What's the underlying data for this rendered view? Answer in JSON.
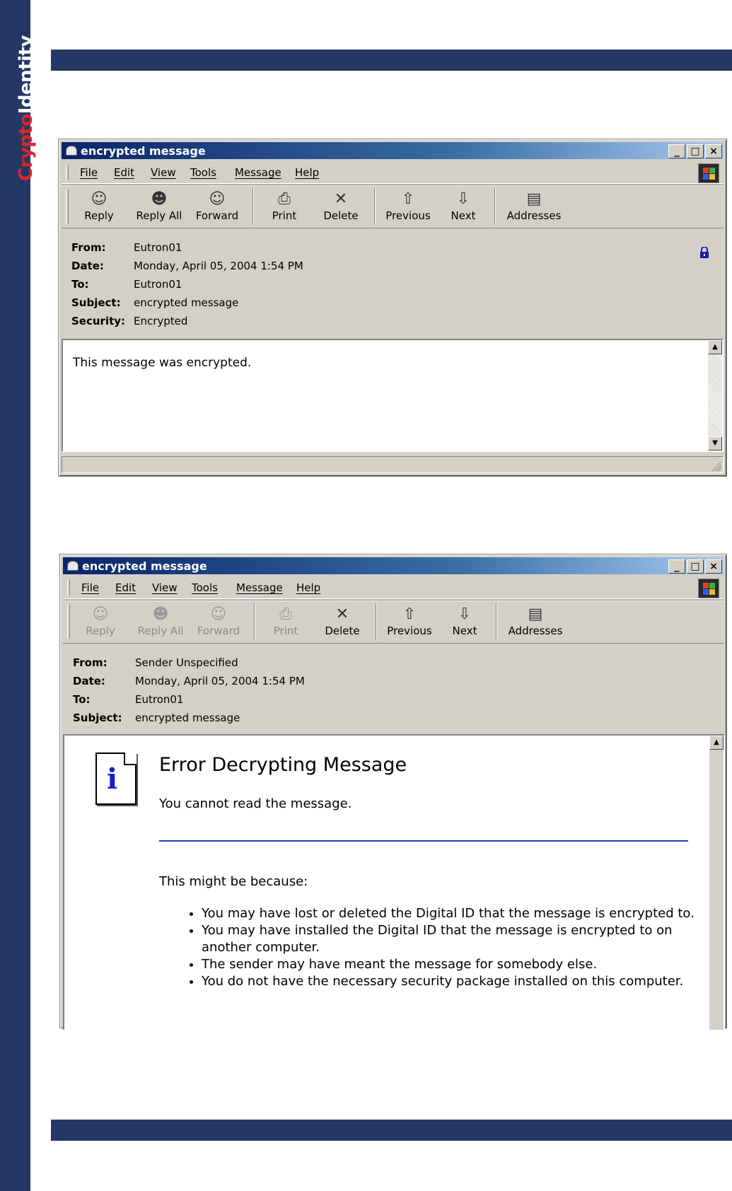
{
  "brand": {
    "logo_part1": "Crypto",
    "logo_part2": "Identity",
    "colors": {
      "band": "#243866",
      "logo_red": "#d9262c"
    }
  },
  "window1": {
    "title": "encrypted message",
    "menu": [
      "File",
      "Edit",
      "View",
      "Tools",
      "Message",
      "Help"
    ],
    "toolbar": [
      {
        "label": "Reply",
        "icon": "reply-icon",
        "enabled": true
      },
      {
        "label": "Reply All",
        "icon": "reply-all-icon",
        "enabled": true
      },
      {
        "label": "Forward",
        "icon": "forward-icon",
        "enabled": true
      },
      {
        "label": "Print",
        "icon": "printer-icon",
        "enabled": true
      },
      {
        "label": "Delete",
        "icon": "delete-x-icon",
        "enabled": true
      },
      {
        "label": "Previous",
        "icon": "arrow-up-icon",
        "enabled": true
      },
      {
        "label": "Next",
        "icon": "arrow-down-icon",
        "enabled": true
      },
      {
        "label": "Addresses",
        "icon": "address-book-icon",
        "enabled": true
      }
    ],
    "headers": {
      "from_label": "From:",
      "from": "Eutron01",
      "date_label": "Date:",
      "date": "Monday, April 05, 2004 1:54 PM",
      "to_label": "To:",
      "to": "Eutron01",
      "subject_label": "Subject:",
      "subject": "encrypted message",
      "security_label": "Security:",
      "security": "Encrypted"
    },
    "body": "This message was encrypted."
  },
  "window2": {
    "title": "encrypted message",
    "menu": [
      "File",
      "Edit",
      "View",
      "Tools",
      "Message",
      "Help"
    ],
    "toolbar": [
      {
        "label": "Reply",
        "icon": "reply-icon",
        "enabled": false
      },
      {
        "label": "Reply All",
        "icon": "reply-all-icon",
        "enabled": false
      },
      {
        "label": "Forward",
        "icon": "forward-icon",
        "enabled": false
      },
      {
        "label": "Print",
        "icon": "printer-icon",
        "enabled": false
      },
      {
        "label": "Delete",
        "icon": "delete-x-icon",
        "enabled": true
      },
      {
        "label": "Previous",
        "icon": "arrow-up-icon",
        "enabled": true
      },
      {
        "label": "Next",
        "icon": "arrow-down-icon",
        "enabled": true
      },
      {
        "label": "Addresses",
        "icon": "address-book-icon",
        "enabled": true
      }
    ],
    "headers": {
      "from_label": "From:",
      "from": "Sender Unspecified",
      "date_label": "Date:",
      "date": "Monday, April 05, 2004 1:54 PM",
      "to_label": "To:",
      "to": "Eutron01",
      "subject_label": "Subject:",
      "subject": "encrypted message"
    },
    "error": {
      "title": "Error Decrypting Message",
      "subtitle": "You cannot read the message.",
      "intro": "This might be because:",
      "reasons": [
        "You may have lost or deleted the Digital ID that the message is encrypted to.",
        "You may have installed the Digital ID that the message is encrypted to on another computer.",
        "The sender may have meant the message for somebody else.",
        "You do not have the necessary security package installed on this computer."
      ]
    }
  }
}
